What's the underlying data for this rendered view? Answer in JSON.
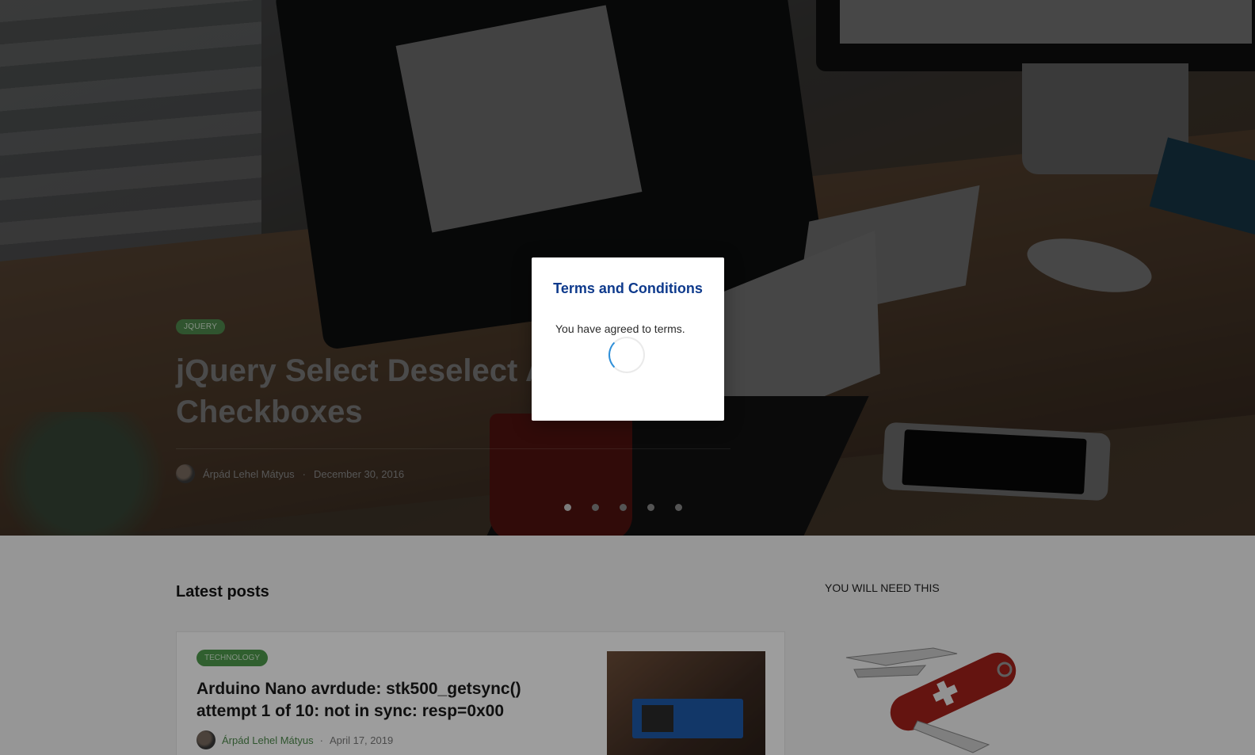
{
  "hero": {
    "tag": "JQUERY",
    "title": "jQuery Select Deselect All Checkboxes",
    "title_visible": "jQuery Select Deselect \nCheckboxes",
    "author": "Árpád Lehel Mátyus",
    "separator": "·",
    "date": "December 30, 2016",
    "slides": 5,
    "active_slide": 1
  },
  "main": {
    "section_title": "Latest posts",
    "posts": [
      {
        "tag": "TECHNOLOGY",
        "title": "Arduino Nano avrdude: stk500_getsync() attempt 1 of 10: not in sync: resp=0x00",
        "author": "Árpád Lehel Mátyus",
        "separator": "·",
        "date": "April 17, 2019"
      }
    ]
  },
  "sidebar": {
    "widget_title": "YOU WILL NEED THIS"
  },
  "modal": {
    "title": "Terms and Conditions",
    "message": "You have agreed to terms."
  },
  "colors": {
    "modal_title": "#0e3a8c",
    "tag_green": "#4f9a4d",
    "spinner": "#2f8fd8"
  }
}
